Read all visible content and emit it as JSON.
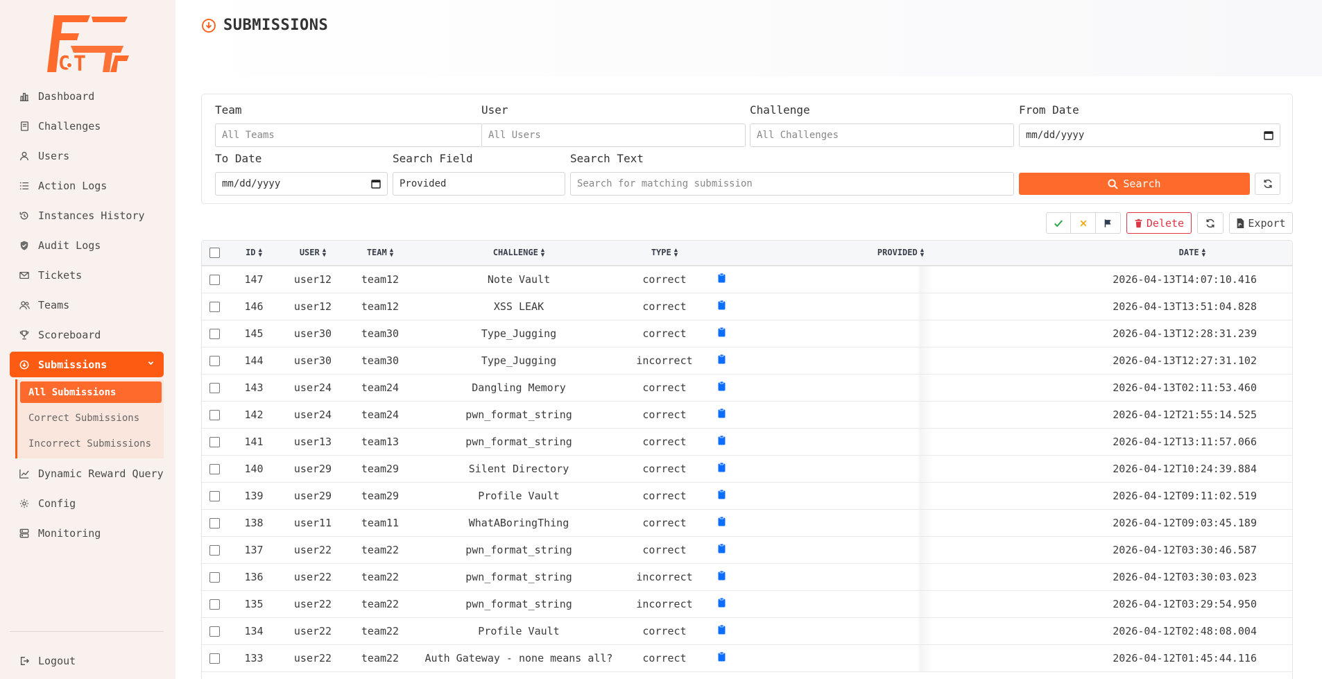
{
  "brand": {
    "logo_text": "FCTF",
    "accent": "#fd5a12"
  },
  "sidebar": {
    "items": [
      {
        "label": "Dashboard",
        "icon": "bar-chart-icon"
      },
      {
        "label": "Challenges",
        "icon": "book-icon"
      },
      {
        "label": "Users",
        "icon": "user-icon"
      },
      {
        "label": "Action Logs",
        "icon": "list-icon"
      },
      {
        "label": "Instances History",
        "icon": "history-icon"
      },
      {
        "label": "Audit Logs",
        "icon": "shield-icon"
      },
      {
        "label": "Tickets",
        "icon": "mail-icon"
      },
      {
        "label": "Teams",
        "icon": "users-icon"
      },
      {
        "label": "Scoreboard",
        "icon": "trophy-icon"
      },
      {
        "label": "Submissions",
        "icon": "download-circle-icon"
      }
    ],
    "submissions_sub": [
      "All Submissions",
      "Correct Submissions",
      "Incorrect Submissions"
    ],
    "items_after": [
      {
        "label": "Dynamic Reward Query",
        "icon": "line-chart-icon"
      },
      {
        "label": "Config",
        "icon": "gear-icon"
      },
      {
        "label": "Monitoring",
        "icon": "server-icon"
      }
    ],
    "logout": "Logout"
  },
  "page": {
    "title": "SUBMISSIONS"
  },
  "filters": {
    "team": {
      "label": "Team",
      "placeholder": "All Teams"
    },
    "user": {
      "label": "User",
      "placeholder": "All Users"
    },
    "challenge": {
      "label": "Challenge",
      "placeholder": "All Challenges"
    },
    "from_date": {
      "label": "From Date",
      "value": "mm/dd/yyyy"
    },
    "to_date": {
      "label": "To Date",
      "value": "mm/dd/yyyy"
    },
    "search_field": {
      "label": "Search Field",
      "value": "Provided"
    },
    "search_text": {
      "label": "Search Text",
      "placeholder": "Search for matching submission"
    },
    "search_button": "Search"
  },
  "toolbar": {
    "delete": "Delete",
    "export": "Export"
  },
  "table": {
    "columns": [
      "ID",
      "USER",
      "TEAM",
      "CHALLENGE",
      "TYPE",
      "PROVIDED",
      "DATE"
    ],
    "rows": [
      {
        "id": "147",
        "user": "user12",
        "team": "team12",
        "challenge": "Note Vault",
        "type": "correct",
        "date": "2026-04-13T14:07:10.416"
      },
      {
        "id": "146",
        "user": "user12",
        "team": "team12",
        "challenge": "XSS LEAK",
        "type": "correct",
        "date": "2026-04-13T13:51:04.828"
      },
      {
        "id": "145",
        "user": "user30",
        "team": "team30",
        "challenge": "Type_Jugging",
        "type": "correct",
        "date": "2026-04-13T12:28:31.239"
      },
      {
        "id": "144",
        "user": "user30",
        "team": "team30",
        "challenge": "Type_Jugging",
        "type": "incorrect",
        "date": "2026-04-13T12:27:31.102"
      },
      {
        "id": "143",
        "user": "user24",
        "team": "team24",
        "challenge": "Dangling Memory",
        "type": "correct",
        "date": "2026-04-13T02:11:53.460"
      },
      {
        "id": "142",
        "user": "user24",
        "team": "team24",
        "challenge": "pwn_format_string",
        "type": "correct",
        "date": "2026-04-12T21:55:14.525"
      },
      {
        "id": "141",
        "user": "user13",
        "team": "team13",
        "challenge": "pwn_format_string",
        "type": "correct",
        "date": "2026-04-12T13:11:57.066"
      },
      {
        "id": "140",
        "user": "user29",
        "team": "team29",
        "challenge": "Silent Directory",
        "type": "correct",
        "date": "2026-04-12T10:24:39.884"
      },
      {
        "id": "139",
        "user": "user29",
        "team": "team29",
        "challenge": "Profile Vault",
        "type": "correct",
        "date": "2026-04-12T09:11:02.519"
      },
      {
        "id": "138",
        "user": "user11",
        "team": "team11",
        "challenge": "WhatABoringThing",
        "type": "correct",
        "date": "2026-04-12T09:03:45.189"
      },
      {
        "id": "137",
        "user": "user22",
        "team": "team22",
        "challenge": "pwn_format_string",
        "type": "correct",
        "date": "2026-04-12T03:30:46.587"
      },
      {
        "id": "136",
        "user": "user22",
        "team": "team22",
        "challenge": "pwn_format_string",
        "type": "incorrect",
        "date": "2026-04-12T03:30:03.023"
      },
      {
        "id": "135",
        "user": "user22",
        "team": "team22",
        "challenge": "pwn_format_string",
        "type": "incorrect",
        "date": "2026-04-12T03:29:54.950"
      },
      {
        "id": "134",
        "user": "user22",
        "team": "team22",
        "challenge": "Profile Vault",
        "type": "correct",
        "date": "2026-04-12T02:48:08.004"
      },
      {
        "id": "133",
        "user": "user22",
        "team": "team22",
        "challenge": "Auth Gateway - none means all?",
        "type": "correct",
        "date": "2026-04-12T01:45:44.116"
      }
    ]
  }
}
